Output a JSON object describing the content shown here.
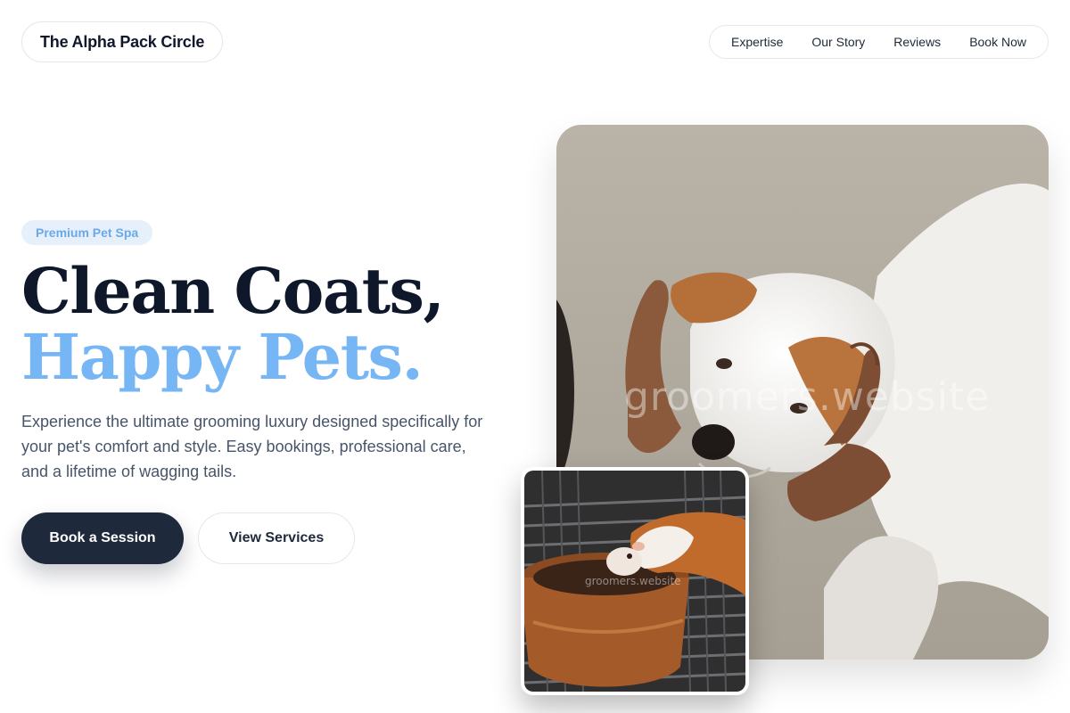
{
  "header": {
    "brand": "The Alpha Pack Circle",
    "nav": [
      "Expertise",
      "Our Story",
      "Reviews",
      "Book Now"
    ]
  },
  "hero": {
    "badge": "Premium Pet Spa",
    "headline_line1": "Clean Coats,",
    "headline_line2": "Happy Pets.",
    "description": "Experience the ultimate grooming luxury designed specifically for your pet's comfort and style. Easy bookings, professional care, and a lifetime of wagging tails.",
    "primary_button": "Book a Session",
    "secondary_button": "View Services"
  },
  "images": {
    "main_alt": "Hands holding a white and brown puppy's face",
    "secondary_alt": "Guinea pig drinking from a ceramic bowl",
    "watermark": "groomers.website"
  },
  "colors": {
    "accent": "#77b6f5",
    "primary_dark": "#1e293b",
    "badge_bg": "#e6f0fb"
  }
}
